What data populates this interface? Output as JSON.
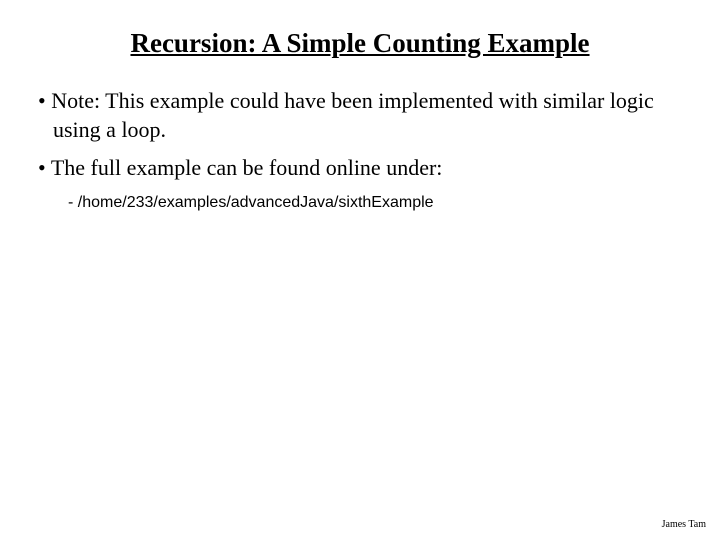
{
  "title": "Recursion: A Simple Counting Example",
  "bullets": [
    {
      "text": "Note: This example could have been implemented with similar logic using a loop."
    },
    {
      "text": "The full example can be found online under:",
      "sub": "/home/233/examples/advancedJava/sixthExample"
    }
  ],
  "footer": "James Tam"
}
